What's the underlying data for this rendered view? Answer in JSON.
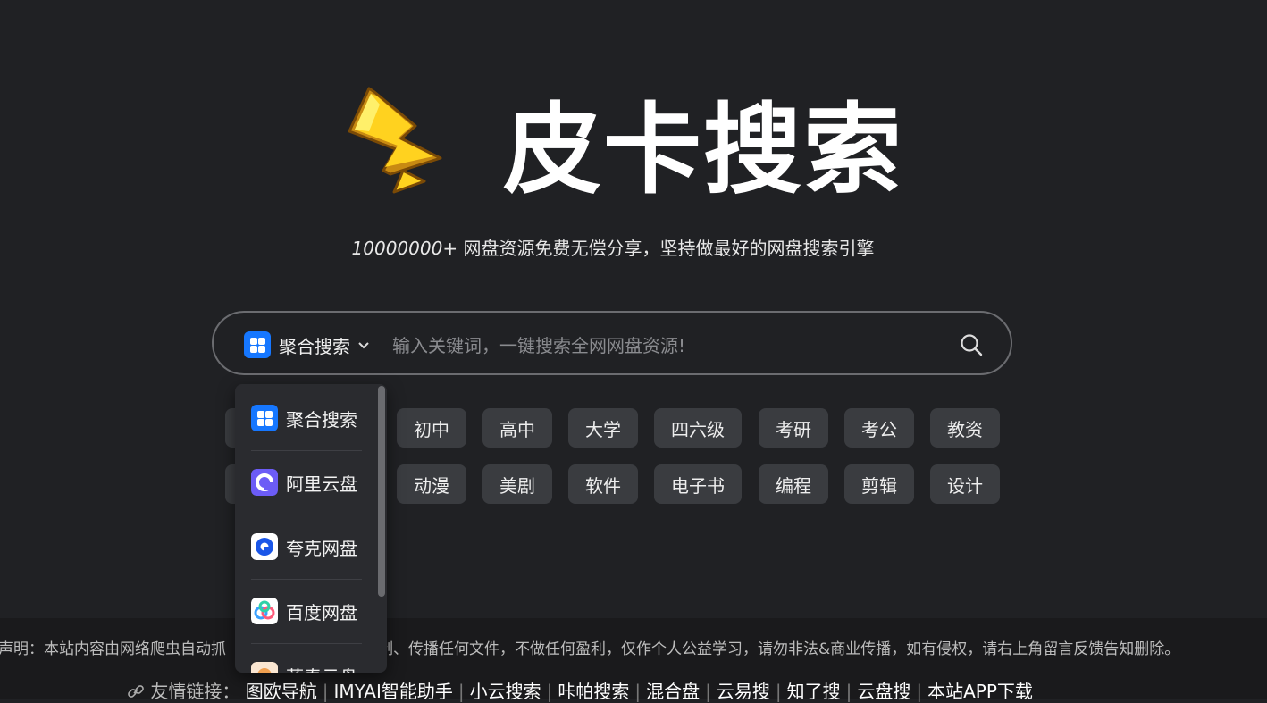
{
  "brand": {
    "title": "皮卡搜索"
  },
  "tagline": {
    "count": "10000000+",
    "text": " 网盘资源免费无偿分享，坚持做最好的网盘搜索引擎"
  },
  "search": {
    "engine_label": "聚合搜索",
    "placeholder": "输入关键词，一键搜索全网网盘资源!",
    "value": ""
  },
  "tags": {
    "row1": [
      "初中",
      "高中",
      "大学",
      "四六级",
      "考研",
      "考公",
      "教资"
    ],
    "row2": [
      "动漫",
      "美剧",
      "软件",
      "电子书",
      "编程",
      "剪辑",
      "设计"
    ]
  },
  "dropdown": {
    "items": [
      {
        "label": "聚合搜索",
        "icon": "aggregate-icon",
        "color": "#1677ff"
      },
      {
        "label": "阿里云盘",
        "icon": "aliyun-drive-icon",
        "color": "#6c5cf6"
      },
      {
        "label": "夸克网盘",
        "icon": "quark-drive-icon",
        "color": "#1a56e8"
      },
      {
        "label": "百度网盘",
        "icon": "baidu-drive-icon",
        "color": "#3aa0ff"
      },
      {
        "label": "蓝奏云盘",
        "icon": "lanzou-drive-icon",
        "color": "#f0a050"
      }
    ]
  },
  "footer": {
    "disclaimer_a": "声明：本站内容由网络爬虫自动抓",
    "disclaimer_b": "制、传播任何文件，不做任何盈利，仅作个人公益学习，请勿非法&商业传播，如有侵权，请右上角留言反馈告知删除。",
    "links_label": "友情链接：",
    "links": [
      "图欧导航",
      "IMYAI智能助手",
      "小云搜索",
      "咔帕搜索",
      "混合盘",
      "云易搜",
      "知了搜",
      "云盘搜",
      "本站APP下载"
    ]
  },
  "colors": {
    "background": "#202124",
    "tag_bg": "#3a3c40",
    "accent": "#1677ff",
    "bolt": "#ffd21f"
  }
}
